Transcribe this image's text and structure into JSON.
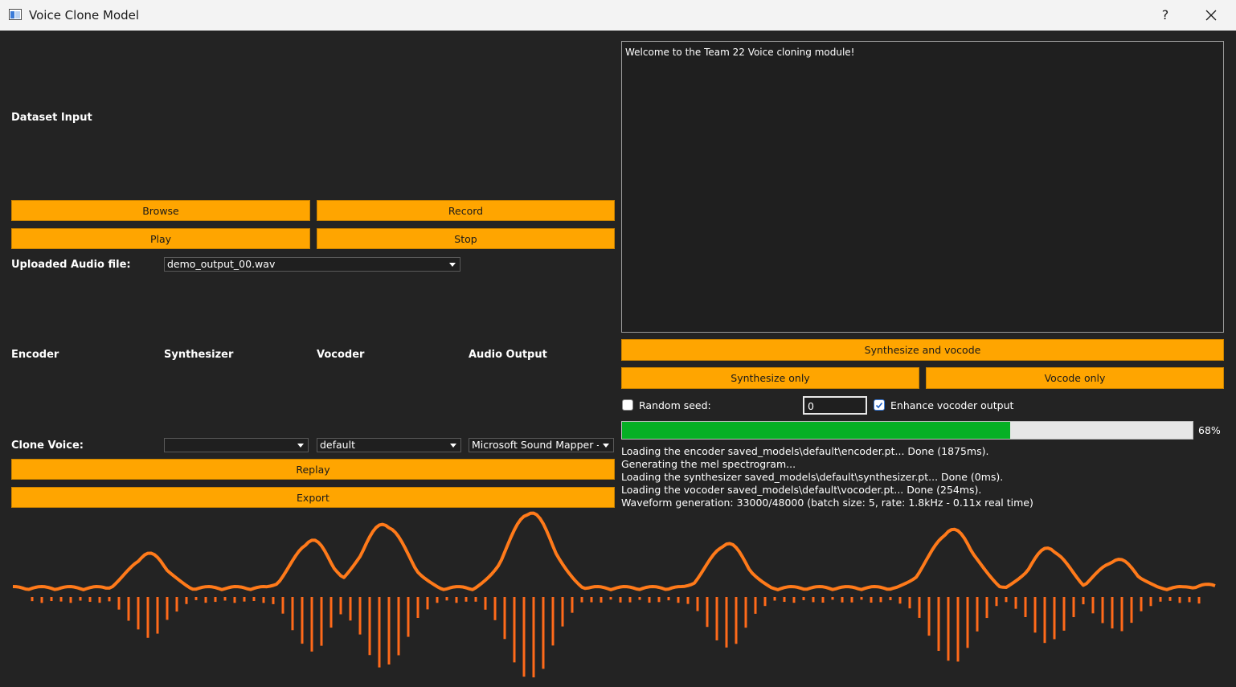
{
  "window": {
    "title": "Voice Clone Model",
    "help_label": "?"
  },
  "left": {
    "dataset_label": "Dataset Input",
    "browse_label": "Browse",
    "record_label": "Record",
    "play_label": "Play",
    "stop_label": "Stop",
    "uploaded_label": "Uploaded Audio file:",
    "uploaded_value": "demo_output_00.wav",
    "headers": {
      "encoder": "Encoder",
      "synthesizer": "Synthesizer",
      "vocoder": "Vocoder",
      "audio_output": "Audio Output"
    },
    "clone_label": "Clone Voice:",
    "clone_combos": {
      "synth_value": "",
      "vocoder_value": "default",
      "output_value": "Microsoft Sound Mapper - Output"
    },
    "replay_label": "Replay",
    "export_label": "Export"
  },
  "right": {
    "log_text": "Welcome to the Team 22 Voice cloning module!",
    "synth_vocode_label": "Synthesize and vocode",
    "synth_only_label": "Synthesize only",
    "vocode_only_label": "Vocode only",
    "random_seed_label": "Random seed:",
    "random_seed_checked": false,
    "seed_value": "0",
    "enhance_label": "Enhance vocoder output",
    "enhance_checked": true,
    "progress_percent": 68,
    "progress_label": "68%",
    "status_lines": [
      "Loading the encoder saved_models\\default\\encoder.pt... Done (1875ms).",
      "Generating the mel spectrogram...",
      "Loading the synthesizer saved_models\\default\\synthesizer.pt... Done (0ms).",
      "Loading the vocoder saved_models\\default\\vocoder.pt... Done (254ms).",
      "Waveform generation: 33000/48000 (batch size: 5, rate: 1.8kHz - 0.11x real time)"
    ]
  },
  "colors": {
    "accent_button": "#ffa500",
    "progress_fill": "#06b025",
    "wave_outline": "#ff7a1a",
    "wave_bar_top": "#ffd27a",
    "wave_bar_bottom": "#ff6a1a"
  }
}
